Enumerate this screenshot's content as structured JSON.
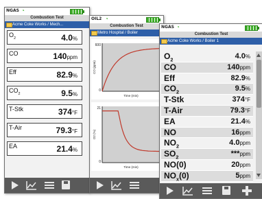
{
  "screen1": {
    "device": "NGAS",
    "title": "Combustion Test",
    "path": "Acme Coke Works / Mech...",
    "rows": [
      {
        "label": "O2",
        "value": "4.0",
        "unit": "%"
      },
      {
        "label": "CO",
        "value": "140",
        "unit": "ppm"
      },
      {
        "label": "Eff",
        "value": "82.9",
        "unit": "%"
      },
      {
        "label": "CO2",
        "value": "9.5",
        "unit": "%"
      },
      {
        "label": "T-Stk",
        "value": "374",
        "unit": "°F"
      },
      {
        "label": "T-Air",
        "value": "79.3",
        "unit": "°F"
      },
      {
        "label": "EA",
        "value": "21.4",
        "unit": "%"
      }
    ]
  },
  "screen2": {
    "device": "OIL2",
    "title": "Combustion Test",
    "path": "Metro Hospital / Boiler",
    "charts": [
      {
        "ylabel": "CO (ppm)",
        "xlabel": "Time (min)",
        "ymax": "600",
        "ymin": "0"
      },
      {
        "ylabel": "O2 (%)",
        "xlabel": "Time (min)",
        "ymax": "21",
        "ymin": "0"
      }
    ]
  },
  "screen3": {
    "device": "NGAS",
    "title": "Combustion Test",
    "path": "Acme Coke Works / Boiler 1",
    "rows": [
      {
        "label": "O2",
        "value": "4.0",
        "unit": "%"
      },
      {
        "label": "CO",
        "value": "140",
        "unit": "ppm"
      },
      {
        "label": "Eff",
        "value": "82.9",
        "unit": "%"
      },
      {
        "label": "CO2",
        "value": "9.5",
        "unit": "%"
      },
      {
        "label": "T-Stk",
        "value": "374",
        "unit": "°F"
      },
      {
        "label": "T-Air",
        "value": "79.3",
        "unit": "°F"
      },
      {
        "label": "EA",
        "value": "21.4",
        "unit": "%"
      },
      {
        "label": "NO",
        "value": "16",
        "unit": "ppm"
      },
      {
        "label": "NO2",
        "value": "4.0",
        "unit": "ppm"
      },
      {
        "label": "SO2",
        "value": "***",
        "unit": "ppm"
      },
      {
        "label": "NO(0)",
        "value": "20",
        "unit": "ppm"
      },
      {
        "label": "NOx(0)",
        "value": "5",
        "unit": "ppm"
      }
    ]
  },
  "icons": {
    "play": "play-icon",
    "graph": "graph-icon",
    "menu": "menu-icon",
    "save": "save-icon",
    "add": "plus-icon",
    "wifi": "wifi-icon",
    "battery": "battery-icon",
    "folder": "folder-icon"
  },
  "colors": {
    "pathbar": "#2e5fa8",
    "battery": "#3fae2a",
    "trace": "#c0392b",
    "toolbar": "#5a5a5a"
  }
}
